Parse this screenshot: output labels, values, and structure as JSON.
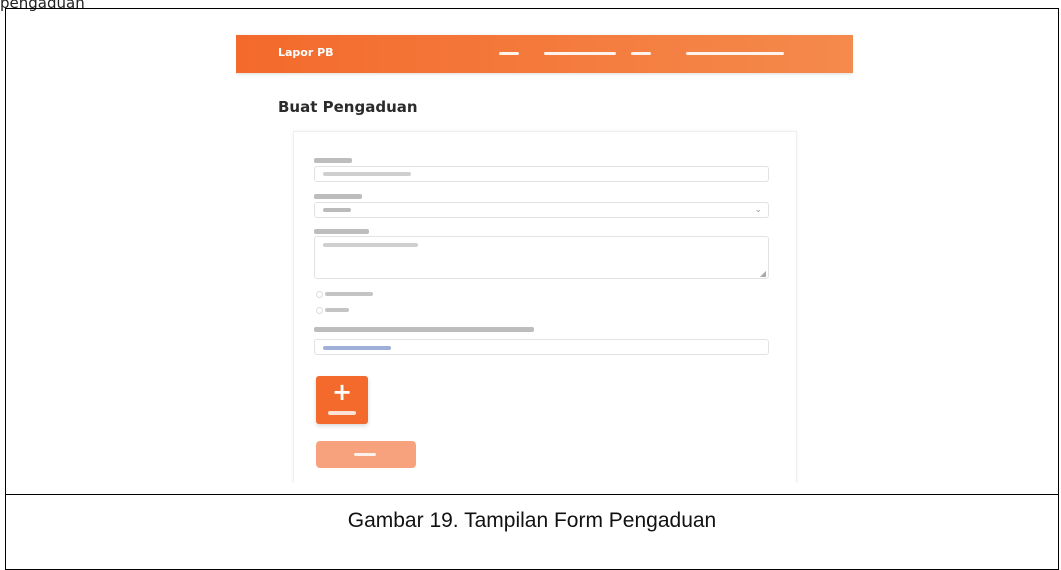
{
  "document": {
    "caption": "Gambar 19. Tampilan Form Pengaduan"
  },
  "navbar": {
    "brand": "Lapor PB",
    "items": [
      {
        "label": ""
      },
      {
        "label": ""
      },
      {
        "label": ""
      },
      {
        "label": ""
      }
    ]
  },
  "page": {
    "title": "Buat Pengaduan"
  },
  "form": {
    "subject_label": "",
    "subject_placeholder": "",
    "type_label": "",
    "type_selected": "",
    "description_label": "",
    "description_placeholder": "",
    "radio_options": [
      {
        "label": ""
      },
      {
        "label": ""
      }
    ],
    "attachment_label": "",
    "attachment_value": "",
    "add_file_label": "",
    "submit_label": ""
  },
  "colors": {
    "accent": "#f36a2c",
    "accent_light": "#f7a27c"
  }
}
